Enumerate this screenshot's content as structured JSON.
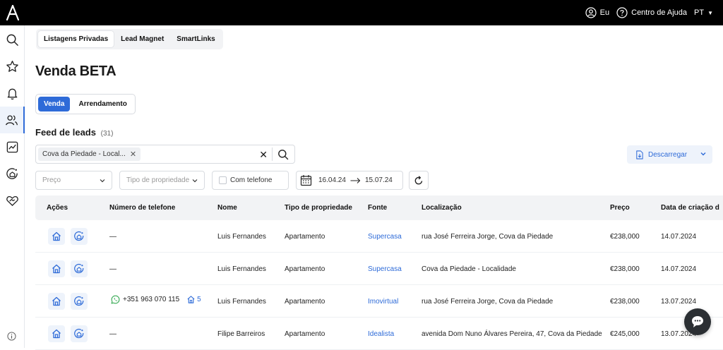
{
  "topbar": {
    "me_label": "Eu",
    "help_label": "Centro de Ajuda",
    "lang_label": "PT"
  },
  "sidebar": {
    "items": [
      {
        "icon": "search-icon"
      },
      {
        "icon": "star-icon"
      },
      {
        "icon": "bell-icon"
      },
      {
        "icon": "users-icon",
        "active": true
      },
      {
        "icon": "chart-icon"
      },
      {
        "icon": "home-sync-icon"
      },
      {
        "icon": "heart-hands-icon"
      }
    ]
  },
  "top_tabs": [
    "Listagens Privadas",
    "Lead Magnet",
    "SmartLinks"
  ],
  "page_title": "Venda BETA",
  "mode_tabs": [
    "Venda",
    "Arrendamento"
  ],
  "feed": {
    "title": "Feed de leads",
    "count": "(31)"
  },
  "search": {
    "chip": "Cova da Piedade - Local..."
  },
  "download_label": "Descarregar",
  "filters": {
    "price_placeholder": "Preço",
    "type_placeholder": "Tipo de propriedade",
    "phone_label": "Com telefone",
    "date_from": "16.04.24",
    "date_to": "15.07.24"
  },
  "table": {
    "headers": [
      "Ações",
      "Número de telefone",
      "Nome",
      "Tipo de propriedade",
      "Fonte",
      "Localização",
      "Preço",
      "Data de criação d"
    ],
    "rows": [
      {
        "phone": "—",
        "has_phone": false,
        "name": "Luis Fernandes",
        "type": "Apartamento",
        "source": "Supercasa",
        "location": "rua José Ferreira Jorge, Cova da Piedade",
        "price": "€238,000",
        "date": "14.07.2024"
      },
      {
        "phone": "—",
        "has_phone": false,
        "name": "Luis Fernandes",
        "type": "Apartamento",
        "source": "Supercasa",
        "location": "Cova da Piedade - Localidade",
        "price": "€238,000",
        "date": "14.07.2024"
      },
      {
        "phone": "+351 963 070 115",
        "has_phone": true,
        "prop_count": "5",
        "name": "Luis Fernandes",
        "type": "Apartamento",
        "source": "Imovirtual",
        "location": "rua José Ferreira Jorge, Cova da Piedade",
        "price": "€238,000",
        "date": "13.07.2024"
      },
      {
        "phone": "—",
        "has_phone": false,
        "name": "Filipe Barreiros",
        "type": "Apartamento",
        "source": "Idealista",
        "location": "avenida Dom Nuno Álvares Pereira, 47, Cova da Piedade",
        "price": "€245,000",
        "date": "13.07.2024"
      }
    ]
  },
  "colors": {
    "accent": "#2e6bd8",
    "topbar": "#000000",
    "header_bg": "#f2f3f5"
  }
}
